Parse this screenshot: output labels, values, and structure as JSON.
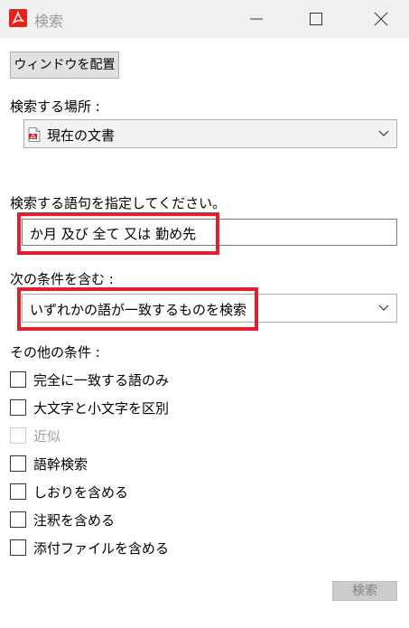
{
  "window": {
    "title": "検索",
    "icon": "acrobat-icon",
    "controls": [
      "minimize-icon",
      "maximize-icon",
      "close-icon"
    ]
  },
  "toolbar": {
    "arrange_label": "ウィンドウを配置"
  },
  "location": {
    "label": "検索する場所 :",
    "selected": "現在の文書",
    "icon": "pdf-document-icon"
  },
  "query": {
    "label": "検索する語句を指定してください。",
    "value": "か月 及び 全て 又は 勤め先"
  },
  "criteria": {
    "label": "次の条件を含む :",
    "selected": "いずれかの語が一致するものを検索"
  },
  "other": {
    "label": "その他の条件 :",
    "options": [
      {
        "label": "完全に一致する語のみ",
        "checked": false,
        "enabled": true
      },
      {
        "label": "大文字と小文字を区別",
        "checked": false,
        "enabled": true
      },
      {
        "label": "近似",
        "checked": false,
        "enabled": false
      },
      {
        "label": "語幹検索",
        "checked": false,
        "enabled": true
      },
      {
        "label": "しおりを含める",
        "checked": false,
        "enabled": true
      },
      {
        "label": "注釈を含める",
        "checked": false,
        "enabled": true
      },
      {
        "label": "添付ファイルを含める",
        "checked": false,
        "enabled": true
      }
    ]
  },
  "footer": {
    "search_label": "検索"
  },
  "colors": {
    "highlight": "#e0202e",
    "titlebar": "#f0f0f0",
    "brand": "#e2231a"
  }
}
